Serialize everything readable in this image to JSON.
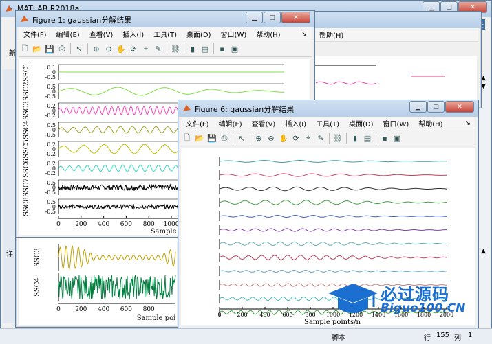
{
  "matlab": {
    "title": "MATLAB R2018a",
    "status_script": "脚本",
    "status_row_label": "行",
    "status_row": "155",
    "status_col_label": "列",
    "status_col": "1",
    "left_tab": "新",
    "left_detail": "详",
    "corner_label": "录"
  },
  "fig1": {
    "title": "Figure 1: gaussian分解结果",
    "menu": [
      "文件(F)",
      "编辑(E)",
      "查看(V)",
      "插入(I)",
      "工具(T)",
      "桌面(D)",
      "窗口(W)",
      "帮助(H)"
    ],
    "ylabels": [
      "SSC1",
      "SSC2",
      "SSC3",
      "SSC4",
      "SSC5",
      "SSC6",
      "SSC7",
      "SSC8"
    ],
    "ticks": [
      [
        "0.1",
        "0",
        "-0.5"
      ],
      [
        "0.5",
        "0",
        "-0.5"
      ],
      [
        "0.2",
        "0",
        "-0.2"
      ],
      [
        "0.5",
        "0",
        "-0.5"
      ],
      [
        "0.2",
        "0",
        "-0.2"
      ],
      [
        "0.2",
        "0",
        "-0.2"
      ],
      [
        "0.5",
        "0",
        "-0.5"
      ],
      [
        "0.5",
        "0",
        "-0.5"
      ]
    ],
    "xticks": [
      "0",
      "200",
      "400",
      "600",
      "800",
      "1000"
    ],
    "xlabel": "Sample poi",
    "colors": [
      "#80e040",
      "#80e040",
      "#ff40c0",
      "#a0a020",
      "#c0c000",
      "#30e0c0",
      "#000000",
      "#000000"
    ]
  },
  "fig_behind": {
    "menu_fragment": "帮助(H)"
  },
  "fig_bottom": {
    "ylabels": [
      "SSC3",
      "SSC4"
    ],
    "xticks": [
      "0",
      "200",
      "400",
      "600",
      "800"
    ],
    "xlabel": "Sample poi",
    "colors": [
      "#c0a000",
      "#008040"
    ]
  },
  "fig6": {
    "title": "Figure 6: gaussian分解结果",
    "menu": [
      "文件(F)",
      "编辑(E)",
      "查看(V)",
      "插入(I)",
      "工具(T)",
      "桌面(D)",
      "窗口(W)",
      "帮助(H)"
    ],
    "xticks": [
      "0",
      "200",
      "400",
      "600",
      "800",
      "1000",
      "1200",
      "1400",
      "1600",
      "1800",
      "2000"
    ],
    "xlabel": "Sample points/n",
    "colors": [
      "#40a0a0",
      "#c04060",
      "#303030",
      "#40a040",
      "#4060c0",
      "#8040a0",
      "#60b0b0",
      "#c04060",
      "#60a0c0",
      "#c08080",
      "#40c0c0",
      "#40a040"
    ]
  },
  "watermark": {
    "text_cn": "必过源码",
    "text_en": "Biguo100.CN",
    "colors": {
      "blue": "#1a6fd0",
      "red": "#d02020"
    }
  }
}
